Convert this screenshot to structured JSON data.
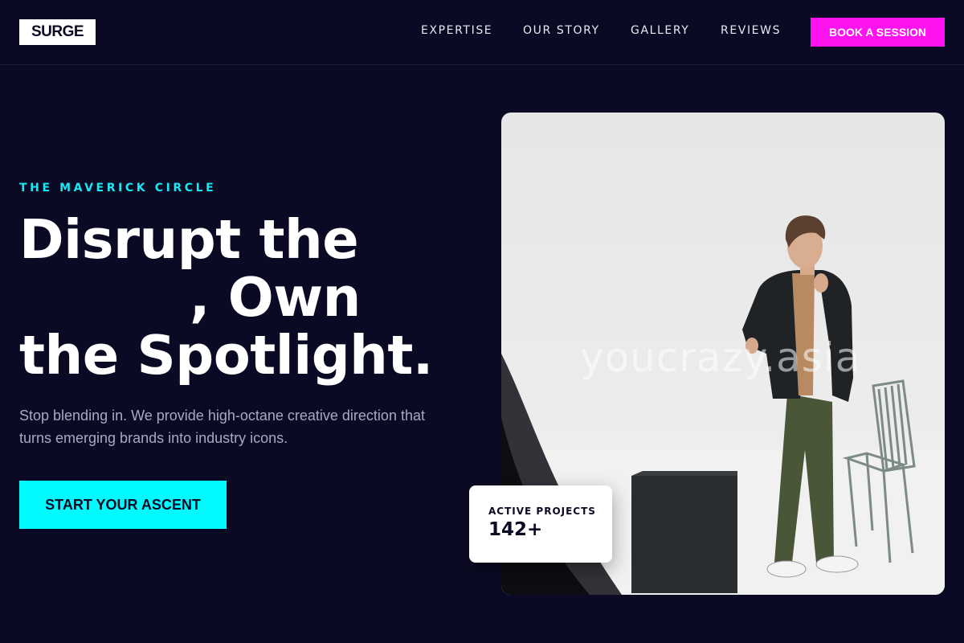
{
  "brand": {
    "logo": "SURGE"
  },
  "nav": {
    "links": [
      "EXPERTISE",
      "OUR STORY",
      "GALLERY",
      "REVIEWS"
    ],
    "cta": "BOOK A SESSION"
  },
  "hero": {
    "eyebrow": "THE MAVERICK CIRCLE",
    "headline_line1": "Disrupt the",
    "headline_line2": ", Own",
    "headline_line3": "the Spotlight.",
    "subcopy": "Stop blending in. We provide high-octane creative direction that turns emerging brands into industry icons.",
    "cta": "START YOUR ASCENT",
    "image_watermark": "youcrazy.asia"
  },
  "stat": {
    "label": "ACTIVE PROJECTS",
    "value": "142+"
  },
  "colors": {
    "background": "#0b0a24",
    "accent_magenta": "#ff12f0",
    "accent_cyan": "#00fbff",
    "eyebrow_cyan": "#19e9f3"
  }
}
